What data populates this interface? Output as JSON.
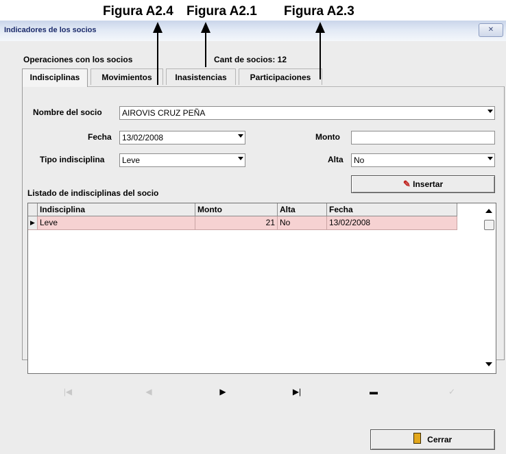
{
  "captions": [
    "Figura A2.4",
    "Figura A2.1",
    "Figura A2.3"
  ],
  "window": {
    "title": "Indicadores de los socios",
    "close_label": "✕"
  },
  "panel": {
    "heading": "Operaciones con los socios",
    "count_text": "Cant de socios: 12"
  },
  "tabs": [
    {
      "label": "Indisciplinas",
      "active": true
    },
    {
      "label": "Movimientos",
      "active": false
    },
    {
      "label": "Inasistencias",
      "active": false
    },
    {
      "label": "Participaciones",
      "active": false
    }
  ],
  "form": {
    "socio_label": "Nombre del socio",
    "socio_value": "AIROVIS CRUZ PEÑA",
    "fecha_label": "Fecha",
    "fecha_value": "13/02/2008",
    "monto_label": "Monto",
    "monto_value": "",
    "tipo_label": "Tipo indisciplina",
    "tipo_value": "Leve",
    "alta_label": "Alta",
    "alta_value": "No",
    "insert_label": "Insertar",
    "listado_label": "Listado de indisciplinas del socio"
  },
  "grid": {
    "columns": [
      "Indisciplina",
      "Monto",
      "Alta",
      "Fecha"
    ],
    "rows": [
      [
        "Leve",
        "21",
        "No",
        "13/02/2008"
      ]
    ]
  },
  "nav": {
    "icons": [
      "first-icon",
      "prior-icon",
      "next-icon",
      "last-icon",
      "delete-icon",
      "post-icon"
    ]
  },
  "footer": {
    "close_label": "Cerrar"
  },
  "colors": {
    "row_selected": "#f6d2d2",
    "title_text": "#1a2a6a"
  }
}
